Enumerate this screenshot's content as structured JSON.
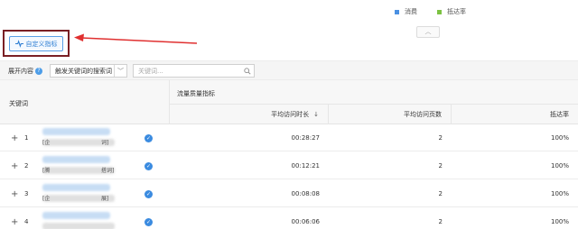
{
  "legend": [
    {
      "label": "消费",
      "color": "#4a90e2"
    },
    {
      "label": "抵达率",
      "color": "#7cc242"
    }
  ],
  "custom_metrics_button": "自定义指标",
  "filter": {
    "label": "展开内容",
    "select_value": "触发关键词的搜索词",
    "search_placeholder": "关键词..."
  },
  "table": {
    "keyword_header": "关键词",
    "group_header": "流量质量指标",
    "columns": [
      "平均访问时长",
      "平均访问页数",
      "抵达率"
    ],
    "rows": [
      {
        "index": "1",
        "keyword_prefix": "[企",
        "keyword_suffix": "词]",
        "avg_duration": "00:28:27",
        "avg_pages": "2",
        "arrival_rate": "100%"
      },
      {
        "index": "2",
        "keyword_prefix": "[腾",
        "keyword_suffix": "搭词]",
        "avg_duration": "00:12:21",
        "avg_pages": "2",
        "arrival_rate": "100%"
      },
      {
        "index": "3",
        "keyword_prefix": "[企",
        "keyword_suffix": "展]",
        "avg_duration": "00:08:08",
        "avg_pages": "2",
        "arrival_rate": "100%"
      },
      {
        "index": "4",
        "keyword_prefix": "",
        "keyword_suffix": "",
        "avg_duration": "00:06:06",
        "avg_pages": "2",
        "arrival_rate": "100%"
      }
    ]
  }
}
